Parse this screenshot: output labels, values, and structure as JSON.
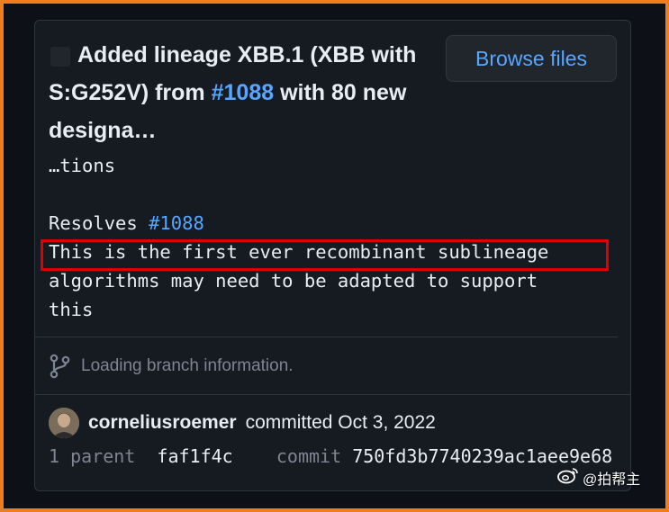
{
  "commit": {
    "title_part1": "Added lineage XBB.1 (XBB with S:G252V) from ",
    "title_link": "#1088",
    "title_part2": " with 80 new designa…",
    "browse_files_label": "Browse files",
    "body": {
      "continuation": "…tions",
      "resolves_prefix": "Resolves ",
      "resolves_link": "#1088",
      "highlighted_line": "This is the first ever recombinant sublineage",
      "line_algorithms": "algorithms may need to be adapted to support",
      "line_this": "this"
    },
    "branch_info": "Loading branch information.",
    "author": "corneliusroemer",
    "committed_text": "committed Oct 3, 2022",
    "parent_label": "1 parent",
    "parent_sha": "faf1f4c",
    "commit_label": "commit",
    "commit_sha": "750fd3b7740239ac1aee9e68"
  },
  "watermark": {
    "text": "@拍帮主"
  },
  "colors": {
    "frame_border": "#ef7d1c",
    "background": "#0d1117",
    "link": "#58a6ff",
    "highlight_box": "#e00000"
  },
  "icons": [
    "git-branch-icon",
    "weibo-icon"
  ]
}
